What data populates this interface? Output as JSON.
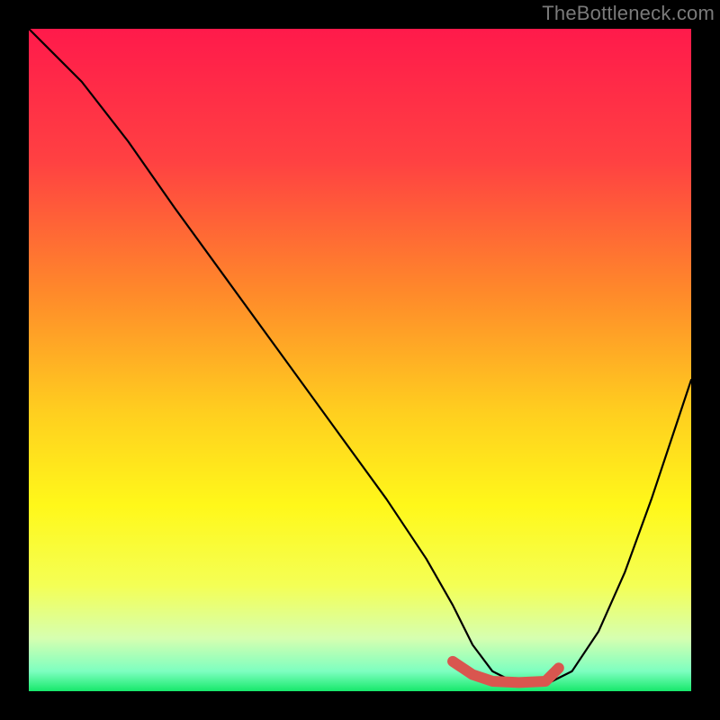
{
  "watermark": "TheBottleneck.com",
  "chart_data": {
    "type": "line",
    "title": "",
    "xlabel": "",
    "ylabel": "",
    "xlim": [
      0,
      100
    ],
    "ylim": [
      0,
      100
    ],
    "grid": false,
    "legend": false,
    "series": [
      {
        "name": "bottleneck-curve",
        "x": [
          0,
          3,
          8,
          15,
          22,
          30,
          38,
          46,
          54,
          60,
          64,
          67,
          70,
          74,
          78,
          82,
          86,
          90,
          94,
          98,
          100
        ],
        "y": [
          100,
          97,
          92,
          83,
          73,
          62,
          51,
          40,
          29,
          20,
          13,
          7,
          3,
          1,
          1,
          3,
          9,
          18,
          29,
          41,
          47
        ]
      }
    ],
    "highlight": {
      "name": "optimal-range",
      "x": [
        64,
        67,
        70,
        74,
        78,
        80
      ],
      "y": [
        4.5,
        2.5,
        1.5,
        1.3,
        1.5,
        3.5
      ]
    },
    "gradient_stops": [
      {
        "offset": 0,
        "color": "#ff1a4b"
      },
      {
        "offset": 20,
        "color": "#ff4142"
      },
      {
        "offset": 40,
        "color": "#ff8a2a"
      },
      {
        "offset": 58,
        "color": "#ffcf1f"
      },
      {
        "offset": 72,
        "color": "#fff81a"
      },
      {
        "offset": 84,
        "color": "#f4ff55"
      },
      {
        "offset": 92,
        "color": "#d6ffb0"
      },
      {
        "offset": 97,
        "color": "#7dffc0"
      },
      {
        "offset": 100,
        "color": "#17e86b"
      }
    ]
  }
}
